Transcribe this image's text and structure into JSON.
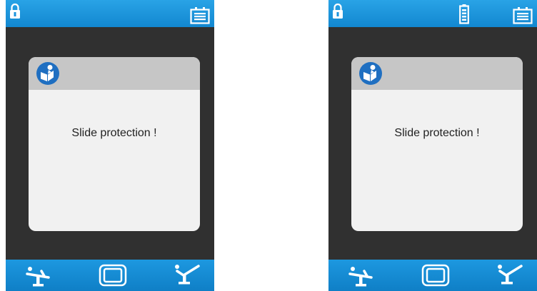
{
  "colors": {
    "bar": "#1a93dc",
    "screen_background": "#303030",
    "dialog_background": "#f1f1f1",
    "dialog_header": "#c6c6c6",
    "manual_icon": "#1f6fc1"
  },
  "screens": [
    {
      "top_icons": [
        "lock-icon",
        "keyboard-icon"
      ],
      "dialog": {
        "icon": "read-manual-icon",
        "message": "Slide protection !"
      },
      "bottom_icons": [
        "chair-flat-position-icon",
        "screen-display-icon",
        "chair-upright-position-icon"
      ]
    },
    {
      "top_icons": [
        "lock-icon",
        "battery-icon",
        "keyboard-icon"
      ],
      "dialog": {
        "icon": "read-manual-icon",
        "message": "Slide protection !"
      },
      "bottom_icons": [
        "chair-flat-position-icon",
        "screen-display-icon",
        "chair-upright-position-icon"
      ]
    }
  ]
}
